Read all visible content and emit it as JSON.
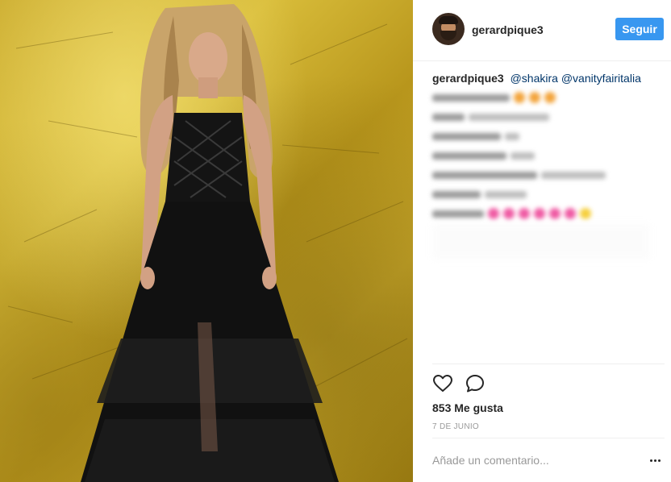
{
  "post": {
    "author": "gerardpique3",
    "follow_label": "Seguir",
    "caption": {
      "author": "gerardpique3",
      "mentions": [
        "@shakira",
        "@vanityfairitalia"
      ]
    },
    "likes_text": "853 Me gusta",
    "date_text": "7 DE JUNIO",
    "comment_placeholder": "Añade un comentario..."
  },
  "icons": {
    "like": "heart-icon",
    "comment": "speech-bubble-icon",
    "more": "ellipsis-icon"
  },
  "colors": {
    "accent": "#3897f0",
    "mention": "#003569",
    "background_photo": "#c9a92a"
  }
}
